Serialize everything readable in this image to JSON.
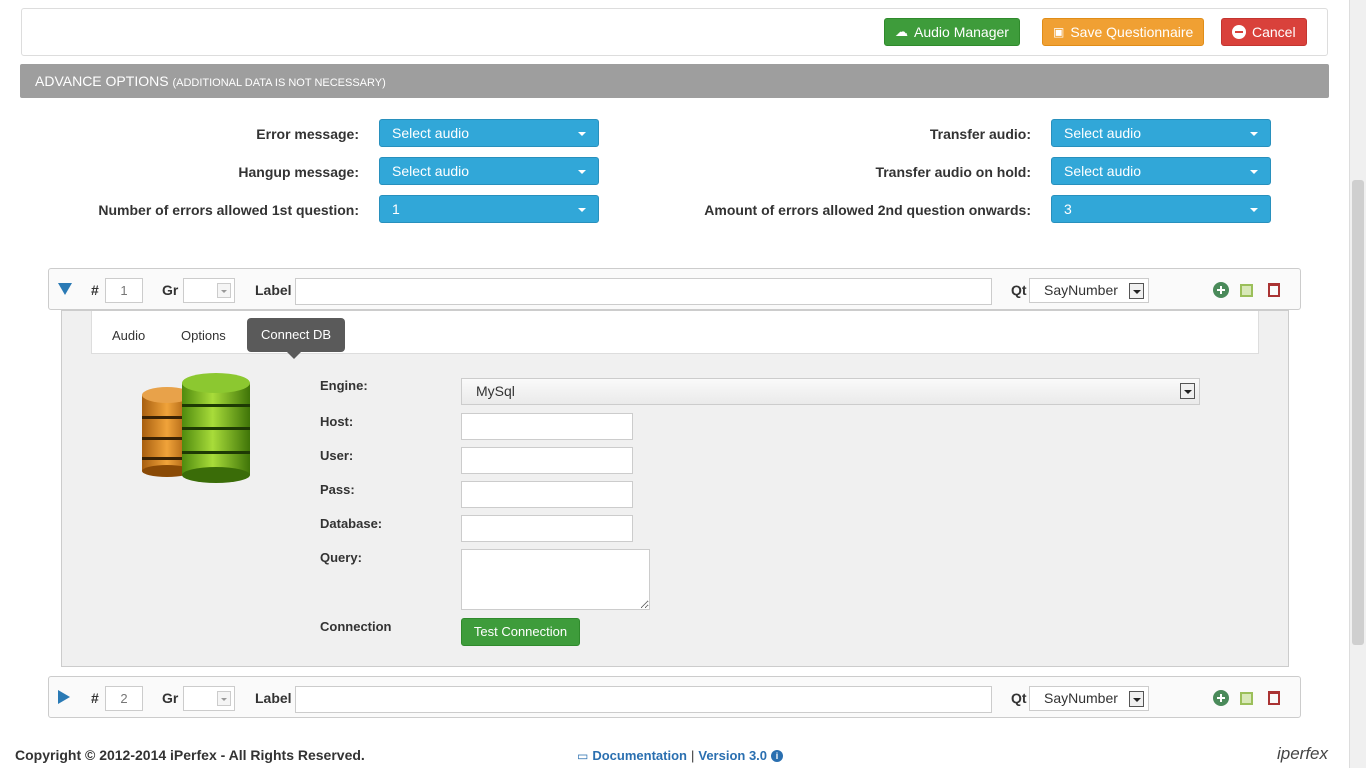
{
  "toolbar": {
    "audio_manager": "Audio Manager",
    "save": "Save Questionnaire",
    "cancel": "Cancel"
  },
  "advance": {
    "title": "ADVANCE OPTIONS",
    "subtitle": "(ADDITIONAL DATA IS NOT NECESSARY)"
  },
  "form": {
    "error_message_label": "Error message:",
    "error_message_value": "Select audio",
    "hangup_message_label": "Hangup message:",
    "hangup_message_value": "Select audio",
    "errors_first_label": "Number of errors allowed 1st question:",
    "errors_first_value": "1",
    "transfer_audio_label": "Transfer audio:",
    "transfer_audio_value": "Select audio",
    "transfer_hold_label": "Transfer audio on hold:",
    "transfer_hold_value": "Select audio",
    "errors_second_label": "Amount of errors allowed 2nd question onwards:",
    "errors_second_value": "3"
  },
  "questions": [
    {
      "hash": "#",
      "number": "1",
      "gr_label": "Gr",
      "label_label": "Label",
      "qt_label": "Qt",
      "qt_value": "SayNumber"
    },
    {
      "hash": "#",
      "number": "2",
      "gr_label": "Gr",
      "label_label": "Label",
      "qt_label": "Qt",
      "qt_value": "SayNumber"
    }
  ],
  "tabs": [
    "Audio",
    "Options",
    "Connect DB"
  ],
  "db": {
    "engine_label": "Engine:",
    "engine_value": "MySql",
    "host_label": "Host:",
    "user_label": "User:",
    "pass_label": "Pass:",
    "database_label": "Database:",
    "query_label": "Query:",
    "connection_label": "Connection",
    "test_button": "Test Connection"
  },
  "footer": {
    "copyright": "Copyright © 2012-2014 iPerfex - All Rights Reserved.",
    "documentation": "Documentation",
    "separator": "|",
    "version": "Version 3.0",
    "brand": "iperfex"
  }
}
